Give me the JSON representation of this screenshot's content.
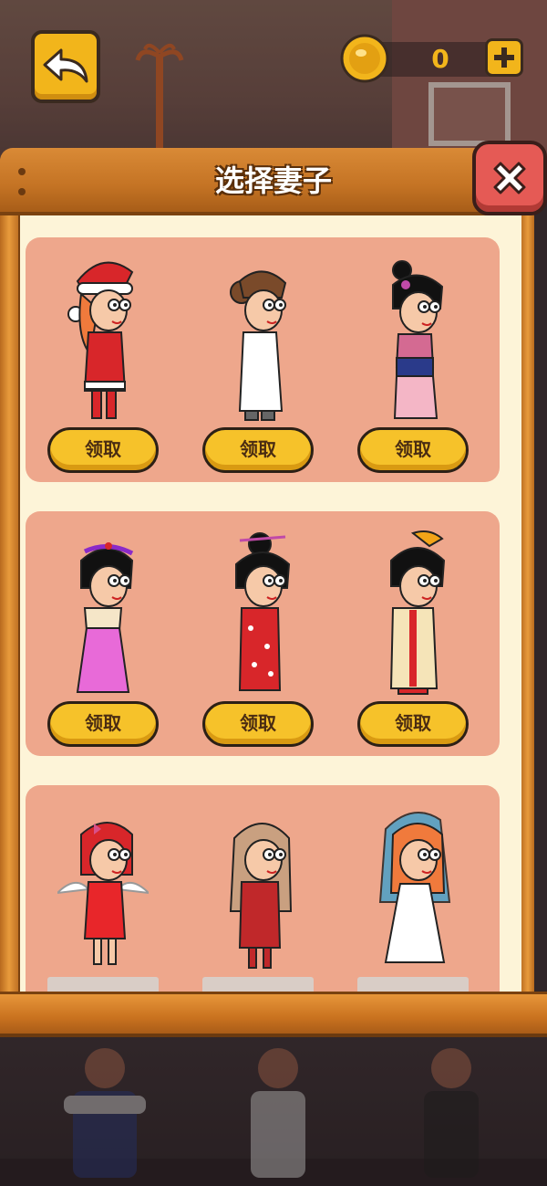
{
  "hud": {
    "coin_count": "0"
  },
  "modal": {
    "title": "选择妻子"
  },
  "rows": [
    {
      "items": [
        {
          "outfit": "santa",
          "button": "领取"
        },
        {
          "outfit": "white-robe",
          "button": "领取"
        },
        {
          "outfit": "hanfu-pink",
          "button": "领取"
        }
      ]
    },
    {
      "items": [
        {
          "outfit": "hanbok-pink",
          "button": "领取"
        },
        {
          "outfit": "kimono-red",
          "button": "领取"
        },
        {
          "outfit": "imperial-gown",
          "button": "领取"
        }
      ]
    },
    {
      "items": [
        {
          "outfit": "cupid"
        },
        {
          "outfit": "red-hoodie"
        },
        {
          "outfit": "white-dress"
        }
      ]
    }
  ],
  "colors": {
    "button_yellow": "#f6c22a",
    "card_salmon": "#eea78c",
    "panel_cream": "#fdf4d8",
    "frame_wood": "#c47324",
    "close_red": "#e55a55"
  }
}
